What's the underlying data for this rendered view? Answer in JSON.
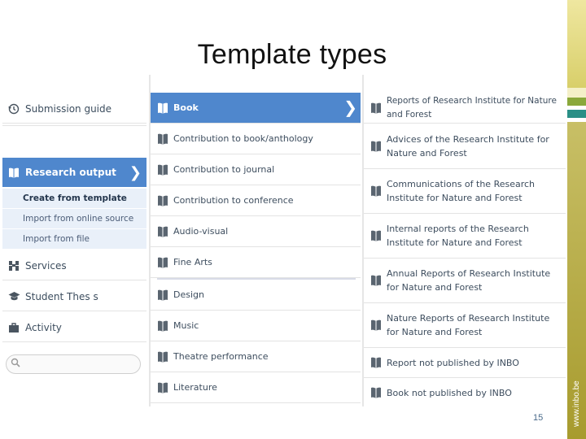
{
  "slide": {
    "title": "Template types",
    "page_number": "15",
    "footer_url": "www.inbo.be"
  },
  "nav": {
    "items": [
      {
        "label": "Submission guide",
        "icon": "history-icon"
      },
      {
        "label": "Research output",
        "icon": "book-icon",
        "active": true
      },
      {
        "label": "Services",
        "icon": "services-icon"
      },
      {
        "label": "Student Thes s",
        "icon": "graduation-cap-icon"
      },
      {
        "label": "Activity",
        "icon": "briefcase-icon"
      }
    ],
    "sub_items": [
      {
        "label": "Create from template",
        "current": true
      },
      {
        "label": "Import from online source"
      },
      {
        "label": "Import from file"
      }
    ],
    "search": {
      "placeholder": "",
      "value": ""
    }
  },
  "templates": [
    {
      "label": "Book",
      "active": true
    },
    {
      "label": "Contribution to book/anthology"
    },
    {
      "label": "Contribution to journal"
    },
    {
      "label": "Contribution to conference"
    },
    {
      "label": "Audio-visual"
    },
    {
      "label": "Fine Arts"
    },
    {
      "label": "Design"
    },
    {
      "label": "Music"
    },
    {
      "label": "Theatre performance"
    },
    {
      "label": "Literature"
    }
  ],
  "book_types": [
    {
      "label": "Reports of Research Institute for Nature and Forest"
    },
    {
      "label": "Advices of the Research Institute for Nature and Forest"
    },
    {
      "label": "Communications of the Research Institute for Nature and Forest"
    },
    {
      "label": "Internal reports of the Research Institute for Nature and Forest"
    },
    {
      "label": "Annual Reports of Research Institute for Nature and Forest"
    },
    {
      "label": "Nature Reports of Research Institute for Nature and Forest"
    },
    {
      "label": "Report not published by INBO"
    },
    {
      "label": "Book not published by INBO"
    }
  ],
  "colors": {
    "accent": "#4f87cd",
    "submenu_bg": "#e9f0f9",
    "band_gold": "#c8bf66"
  }
}
